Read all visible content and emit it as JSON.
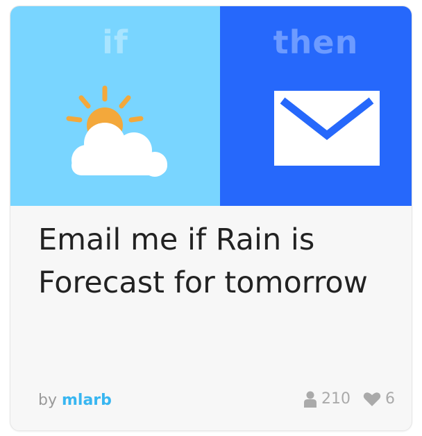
{
  "trigger": {
    "label": "if",
    "icon": "weather-icon",
    "color": "#79d5ff"
  },
  "action": {
    "label": "then",
    "icon": "email-icon",
    "color": "#2668fb"
  },
  "applet": {
    "title": "Email me if Rain is Forecast for tomorrow",
    "by_prefix": "by",
    "author": "mlarb",
    "users_count": "210",
    "users_icon": "user-icon",
    "likes_count": "6",
    "likes_icon": "heart-icon"
  }
}
